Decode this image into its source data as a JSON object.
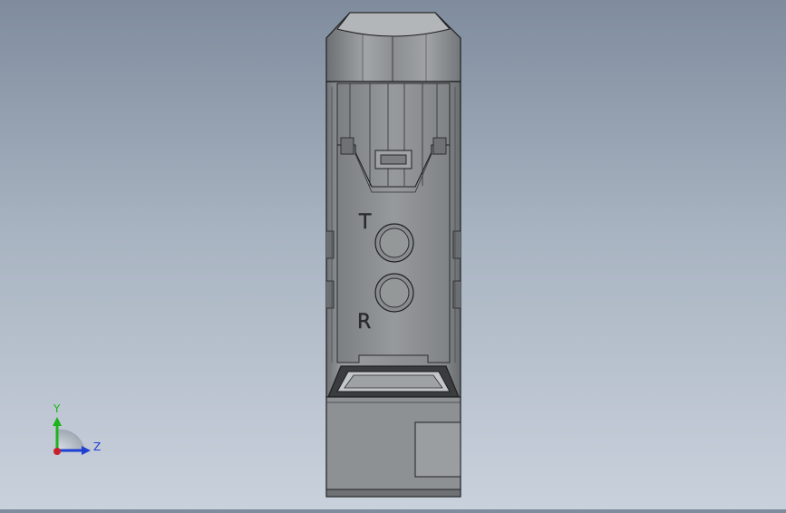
{
  "viewport": {
    "background_top": "#7f8c9d",
    "background_bottom": "#c9d1dc",
    "model_color": "#8e9193",
    "edge_color": "#1e1f21"
  },
  "model": {
    "markings": {
      "top_port_label": "T",
      "bottom_port_label": "R"
    }
  },
  "triad": {
    "y_label": "Y",
    "z_label": "Z",
    "y_color": "#1db31d",
    "z_color": "#1f3fd1",
    "origin_color": "#c8202a"
  }
}
